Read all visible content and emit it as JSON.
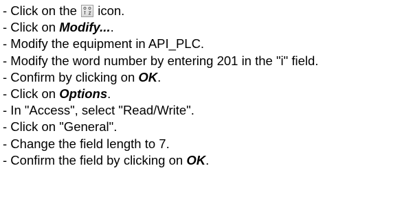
{
  "steps": [
    {
      "pre": "- Click on the ",
      "icon": "variable-grid-icon",
      "post": " icon."
    },
    {
      "pre": "- Click on ",
      "em": "Modify...",
      "post": "."
    },
    {
      "pre": "- Modify the equipment in API_PLC."
    },
    {
      "pre": "- Modify the word number by entering 201 in the \"i\" field."
    },
    {
      "pre": "- Confirm by clicking on ",
      "em": "OK",
      "post": "."
    },
    {
      "pre": "- Click on ",
      "em": "Options",
      "post": "."
    },
    {
      "pre": "- In \"Access\", select \"Read/Write\"."
    },
    {
      "pre": "- Click on \"General\"."
    },
    {
      "pre": "- Change the field length to 7."
    },
    {
      "pre": "- Confirm the field by clicking on ",
      "em": "OK",
      "post": "."
    }
  ]
}
